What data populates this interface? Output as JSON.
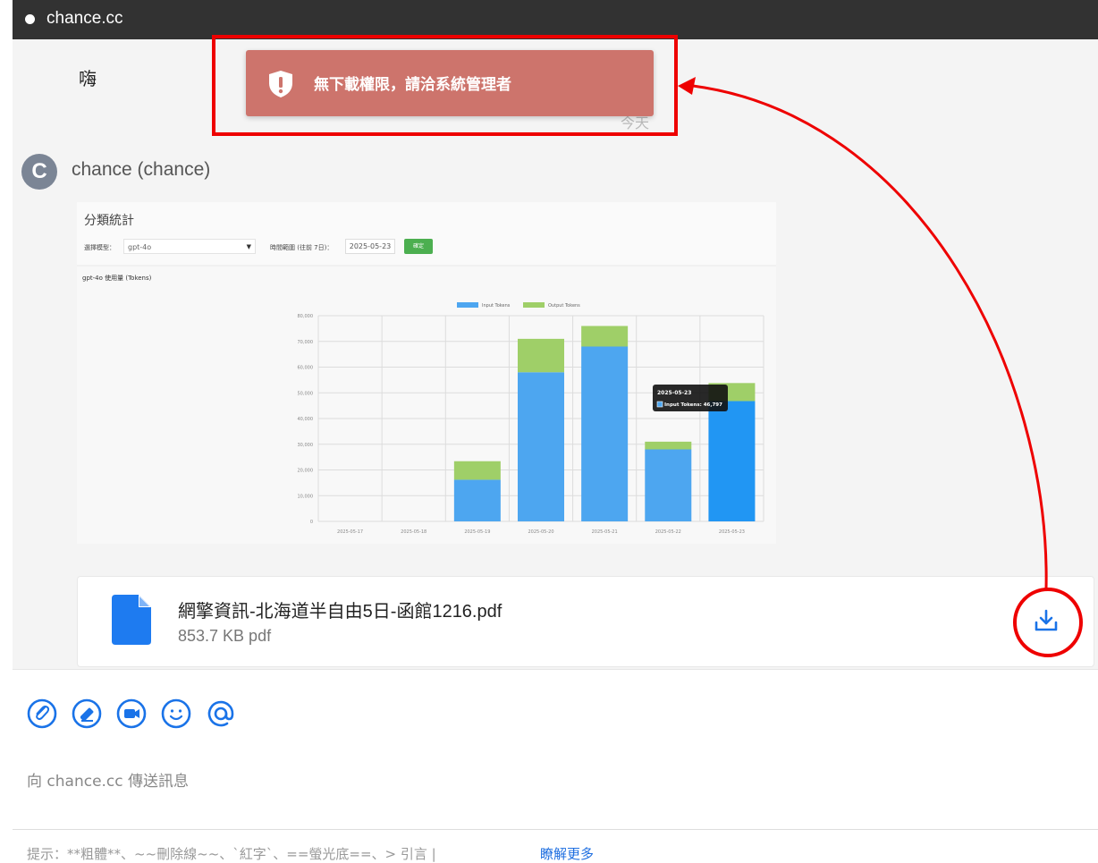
{
  "window": {
    "title": "chance.cc"
  },
  "messages": {
    "previous": {
      "text": "嗨",
      "faded_text": "今天"
    },
    "current": {
      "avatar_letter": "C",
      "sender": "chance (chance)",
      "attachment_image": {
        "panel_title": "分類統計",
        "model_label": "選擇模型：",
        "model_value": "gpt-4o",
        "range_label": "時間範圍 (往前 7日)：",
        "date_value": "2025-05-23",
        "confirm_label": "確定",
        "chart_caption": "gpt-4o 使用量 (Tokens)"
      },
      "file": {
        "name": "網擎資訊-北海道半自由5日-函館1216.pdf",
        "size": "853.7 KB pdf"
      }
    }
  },
  "toast": {
    "message": "無下載權限，請洽系統管理者",
    "icon": "shield-warning-icon"
  },
  "composer": {
    "tools": [
      "paperclip-icon",
      "eraser-icon",
      "video-icon",
      "smiley-icon",
      "at-sign-icon"
    ],
    "placeholder": "向 chance.cc 傳送訊息",
    "hint": "提示：**粗體**、~~刪除線~~、`紅字`、==螢光底==、> 引言  |",
    "hint_link": "瞭解更多"
  },
  "colors": {
    "accent": "#1a73e8",
    "toast_bg": "#cd746c",
    "annotation": "#ee0000"
  },
  "chart_data": {
    "type": "bar",
    "stacked": true,
    "title": "gpt-4o 使用量 (Tokens)",
    "categories": [
      "2025-05-17",
      "2025-05-18",
      "2025-05-19",
      "2025-05-20",
      "2025-05-21",
      "2025-05-22",
      "2025-05-23"
    ],
    "series": [
      {
        "name": "Input Tokens",
        "color": "#4da6f0",
        "values": [
          0,
          0,
          16200,
          58000,
          68000,
          28000,
          46797
        ]
      },
      {
        "name": "Output Tokens",
        "color": "#9fcf68",
        "values": [
          0,
          0,
          7200,
          13000,
          8000,
          3000,
          7000
        ]
      }
    ],
    "yticks": [
      "0",
      "10,000",
      "20,000",
      "30,000",
      "40,000",
      "50,000",
      "60,000",
      "70,000",
      "80,000"
    ],
    "ylim": [
      0,
      80000
    ],
    "legend": "top",
    "grid": true,
    "tooltip": {
      "title": "2025-05-23",
      "label": "Input Tokens: 46,797"
    }
  }
}
